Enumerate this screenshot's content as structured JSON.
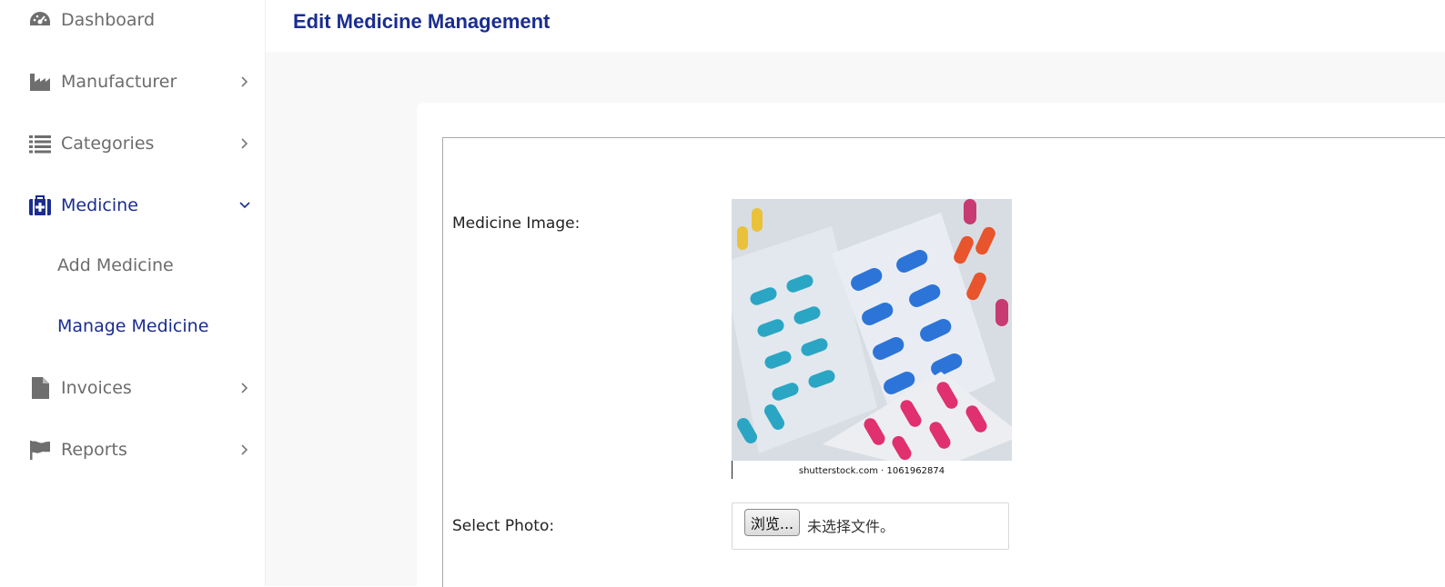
{
  "sidebar": {
    "items": [
      {
        "label": "Dashboard",
        "icon": "gauge-icon"
      },
      {
        "label": "Manufacturer",
        "icon": "industry-icon"
      },
      {
        "label": "Categories",
        "icon": "list-icon"
      },
      {
        "label": "Medicine",
        "icon": "medkit-icon"
      },
      {
        "label": "Invoices",
        "icon": "file-icon"
      },
      {
        "label": "Reports",
        "icon": "flag-icon"
      }
    ],
    "submenu": [
      {
        "label": "Add Medicine"
      },
      {
        "label": "Manage Medicine"
      }
    ]
  },
  "header": {
    "title": "Edit Medicine Management"
  },
  "form": {
    "image_label": "Medicine Image:",
    "image_caption": "shutterstock.com · 1061962874",
    "photo_label": "Select Photo:",
    "browse_label": "浏览...",
    "file_status": "未选择文件。"
  },
  "colors": {
    "accent": "#1a2d8f",
    "text_muted": "#6c6c6c",
    "content_bg": "#f8f8f8"
  }
}
